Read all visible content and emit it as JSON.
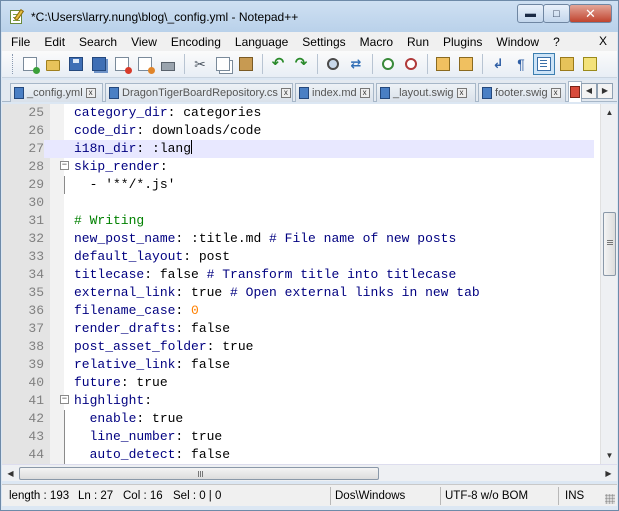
{
  "window": {
    "title": "*C:\\Users\\larry.nung\\blog\\_config.yml - Notepad++",
    "min_glyph": "▬",
    "max_glyph": "□",
    "close_glyph": "✕"
  },
  "menu": {
    "items": [
      "File",
      "Edit",
      "Search",
      "View",
      "Encoding",
      "Language",
      "Settings",
      "Macro",
      "Run",
      "Plugins",
      "Window",
      "?"
    ],
    "close_label": "X"
  },
  "toolbar": {
    "icons": [
      "new-file-icon",
      "open-file-icon",
      "save-icon",
      "save-all-icon",
      "close-icon",
      "close-all-icon",
      "print-icon",
      "cut-icon",
      "copy-icon",
      "paste-icon",
      "undo-icon",
      "redo-icon",
      "find-icon",
      "replace-icon",
      "zoom-in-icon",
      "zoom-out-icon",
      "sync-vertical-icon",
      "sync-horizontal-icon",
      "word-wrap-icon",
      "show-all-chars-icon",
      "indent-guide-icon",
      "user-language-icon",
      "doc-map-icon"
    ]
  },
  "tabs": [
    {
      "label": "_config.yml",
      "active": false
    },
    {
      "label": "DragonTigerBoardRepository.cs",
      "active": false
    },
    {
      "label": "index.md",
      "active": false
    },
    {
      "label": "_layout.swig",
      "active": false
    },
    {
      "label": "footer.swig",
      "active": false
    },
    {
      "label": "",
      "active": true
    }
  ],
  "tab_arrows": {
    "left": "◀",
    "right": "▶"
  },
  "editor": {
    "lines": [
      {
        "num": "25",
        "key": "category_dir",
        "sep": ": ",
        "val": "categories",
        "kind": "plain"
      },
      {
        "num": "26",
        "key": "code_dir",
        "sep": ": ",
        "val": "downloads/code",
        "kind": "plain"
      },
      {
        "num": "27",
        "key": "i18n_dir",
        "sep": ": ",
        "val": ":lang",
        "kind": "plain",
        "current": true
      },
      {
        "num": "28",
        "key": "skip_render",
        "sep": ":",
        "val": "",
        "kind": "plain",
        "fold": "open"
      },
      {
        "num": "29",
        "key": "",
        "sep": "",
        "val": "  - '**/*.js'",
        "kind": "plain",
        "fold": "line"
      },
      {
        "num": "30",
        "key": "",
        "sep": "",
        "val": "",
        "kind": "plain"
      },
      {
        "num": "31",
        "key": "",
        "sep": "",
        "val": "# Writing",
        "kind": "comment"
      },
      {
        "num": "32",
        "key": "new_post_name",
        "sep": ": ",
        "val": ":title.md ",
        "comment": "# File name of new posts",
        "kind": "plain"
      },
      {
        "num": "33",
        "key": "default_layout",
        "sep": ": ",
        "val": "post",
        "kind": "plain"
      },
      {
        "num": "34",
        "key": "titlecase",
        "sep": ": ",
        "val": "false ",
        "comment": "# Transform title into titlecase",
        "kind": "plain"
      },
      {
        "num": "35",
        "key": "external_link",
        "sep": ": ",
        "val": "true ",
        "comment": "# Open external links in new tab",
        "kind": "plain"
      },
      {
        "num": "36",
        "key": "filename_case",
        "sep": ": ",
        "val": "0",
        "kind": "number"
      },
      {
        "num": "37",
        "key": "render_drafts",
        "sep": ": ",
        "val": "false",
        "kind": "plain"
      },
      {
        "num": "38",
        "key": "post_asset_folder",
        "sep": ": ",
        "val": "true",
        "kind": "plain"
      },
      {
        "num": "39",
        "key": "relative_link",
        "sep": ": ",
        "val": "false",
        "kind": "plain"
      },
      {
        "num": "40",
        "key": "future",
        "sep": ": ",
        "val": "true",
        "kind": "plain"
      },
      {
        "num": "41",
        "key": "highlight",
        "sep": ":",
        "val": "",
        "kind": "plain",
        "fold": "open"
      },
      {
        "num": "42",
        "key": "  enable",
        "sep": ": ",
        "val": "true",
        "kind": "plain",
        "fold": "line"
      },
      {
        "num": "43",
        "key": "  line_number",
        "sep": ": ",
        "val": "true",
        "kind": "plain",
        "fold": "line"
      },
      {
        "num": "44",
        "key": "  auto_detect",
        "sep": ": ",
        "val": "false",
        "kind": "plain",
        "fold": "line"
      }
    ],
    "fold_glyph": "−"
  },
  "scroll": {
    "up": "▲",
    "down": "▼",
    "left": "◀",
    "right": "▶"
  },
  "status": {
    "length": "length : 193",
    "ln": "Ln : 27",
    "col": "Col : 16",
    "sel": "Sel : 0 | 0",
    "eol": "Dos\\Windows",
    "encoding": "UTF-8 w/o BOM",
    "mode": "INS"
  },
  "colors": {
    "key": "#000080",
    "comment": "#008000",
    "number": "#ff8000",
    "current_line": "#e8e8ff",
    "gutter": "#e4e4e4"
  }
}
